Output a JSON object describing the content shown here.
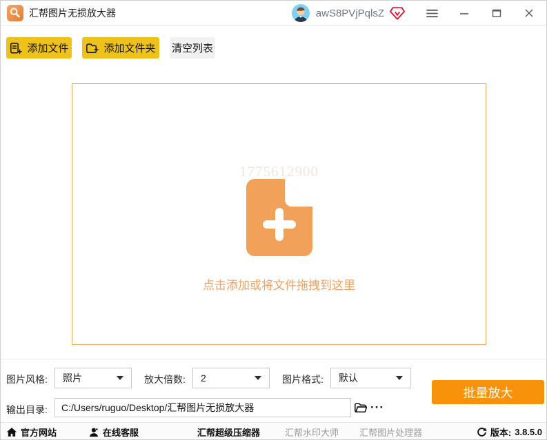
{
  "titlebar": {
    "app_title": "汇帮图片无损放大器",
    "username": "awS8PVjPqlsZ"
  },
  "toolbar": {
    "add_file": "添加文件",
    "add_folder": "添加文件夹",
    "clear_list": "清空列表"
  },
  "dropzone": {
    "watermark": "1775612900",
    "hint": "点击添加或将文件拖拽到这里"
  },
  "settings": {
    "style_label": "图片风格:",
    "style_value": "照片",
    "scale_label": "放大倍数:",
    "scale_value": "2",
    "format_label": "图片格式:",
    "format_value": "默认"
  },
  "actions": {
    "batch_enlarge": "批量放大"
  },
  "output": {
    "label": "输出目录:",
    "path": "C:/Users/ruguo/Desktop/汇帮图片无损放大器",
    "browse_dots": "···"
  },
  "footer": {
    "official_site": "官方网站",
    "online_service": "在线客服",
    "links": [
      "汇帮超级压缩器",
      "汇帮水印大师",
      "汇帮图片处理器"
    ],
    "version_label": "版本:",
    "version_value": "3.8.5.0"
  },
  "icons": {
    "app_logo": "magnifier-on-orange-square",
    "vip_badge": "red-gem-vip",
    "add_file": "document-plus",
    "add_folder": "folder-plus",
    "drop_file": "orange-file-plus",
    "browse": "folder-open",
    "official_site": "house",
    "online_service": "person",
    "version": "refresh-arrow"
  },
  "colors": {
    "accent_yellow": "#efc21b",
    "accent_orange": "#f8920b",
    "drop_border": "#f1a954",
    "hint_text": "#f5a05e"
  }
}
